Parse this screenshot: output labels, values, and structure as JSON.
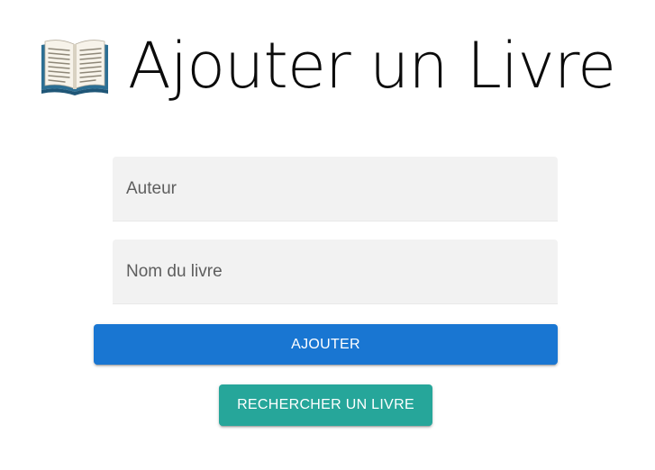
{
  "header": {
    "icon": "open-book-icon",
    "title": "Ajouter un Livre"
  },
  "form": {
    "author_placeholder": "Auteur",
    "author_value": "",
    "book_placeholder": "Nom du livre",
    "book_value": ""
  },
  "actions": {
    "add_label": "AJOUTER",
    "search_label": "RECHERCHER UN LIVRE"
  },
  "colors": {
    "primary": "#1976d2",
    "secondary": "#26a69a",
    "field_bg": "#f2f2f2"
  }
}
